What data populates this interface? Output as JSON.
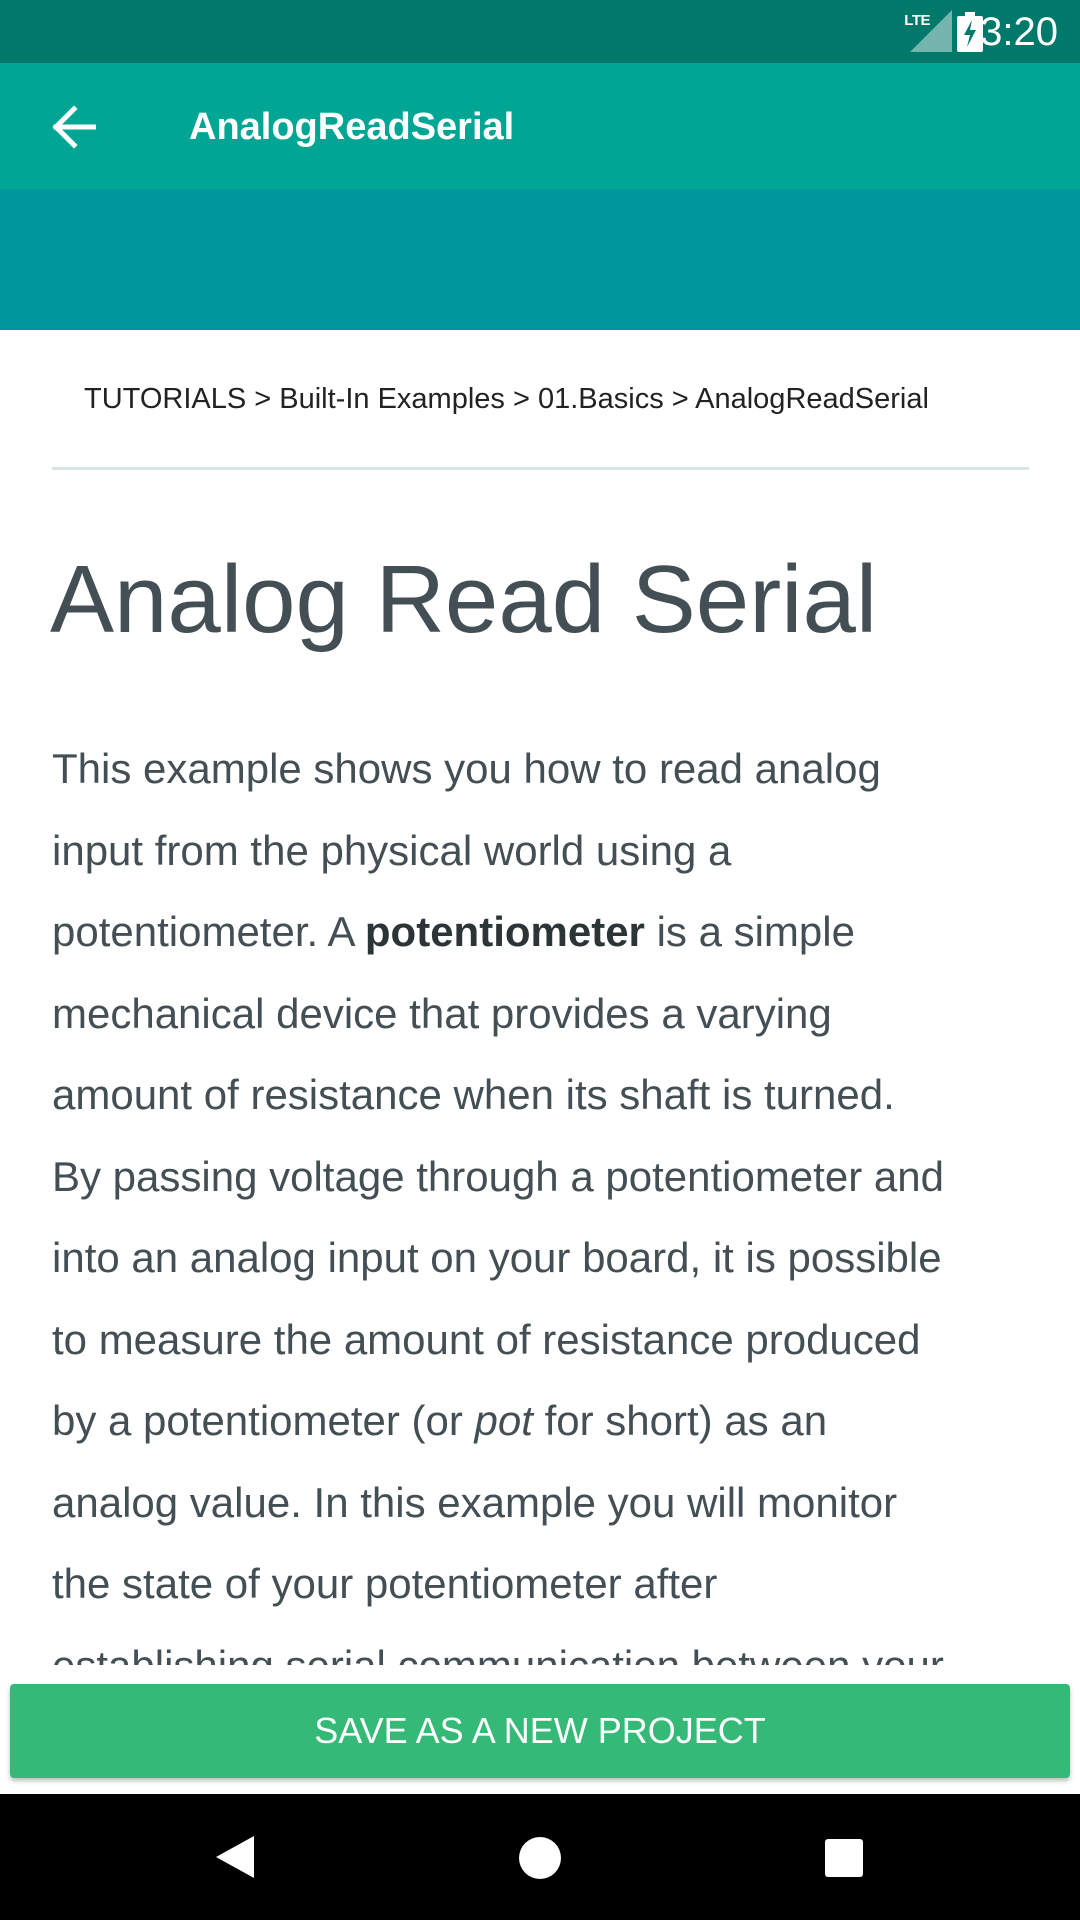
{
  "status_bar": {
    "time": "3:20",
    "network": "LTE",
    "icons": [
      "signal-icon",
      "battery-charging-icon"
    ]
  },
  "app_bar": {
    "title": "AnalogReadSerial",
    "back_icon": "arrow-back-icon"
  },
  "breadcrumb": {
    "text": "TUTORIALS > Built-In Examples > 01.Basics > AnalogReadSerial"
  },
  "content": {
    "heading": "Analog Read Serial",
    "lines": {
      "l1": "This example shows you how to read analog",
      "l2": "input from the physical world using a",
      "l3_a": "potentiometer. A ",
      "l3_b": "potentiometer",
      "l3_c": " is a simple",
      "l4": "mechanical device that provides a varying",
      "l5": "amount of resistance when its shaft is turned.",
      "l6": "By passing voltage through a potentiometer and",
      "l7": "into an analog input on your board, it is possible",
      "l8": "to measure the amount of resistance produced",
      "l9_a": "by a potentiometer (or ",
      "l9_b": "pot",
      "l9_c": " for short) as an",
      "l10": "analog value. In this example you will monitor",
      "l11": "the state of your potentiometer after",
      "l12": "establishing serial communication between your"
    }
  },
  "actions": {
    "save_label": "SAVE AS A NEW PROJECT"
  },
  "nav_bar": {
    "icons": [
      "nav-back-icon",
      "nav-home-icon",
      "nav-recents-icon"
    ]
  },
  "colors": {
    "status_bar": "#00796b",
    "app_bar": "#00a693",
    "hero_band": "#00979c",
    "button": "#35b977",
    "text": "#434f54"
  }
}
